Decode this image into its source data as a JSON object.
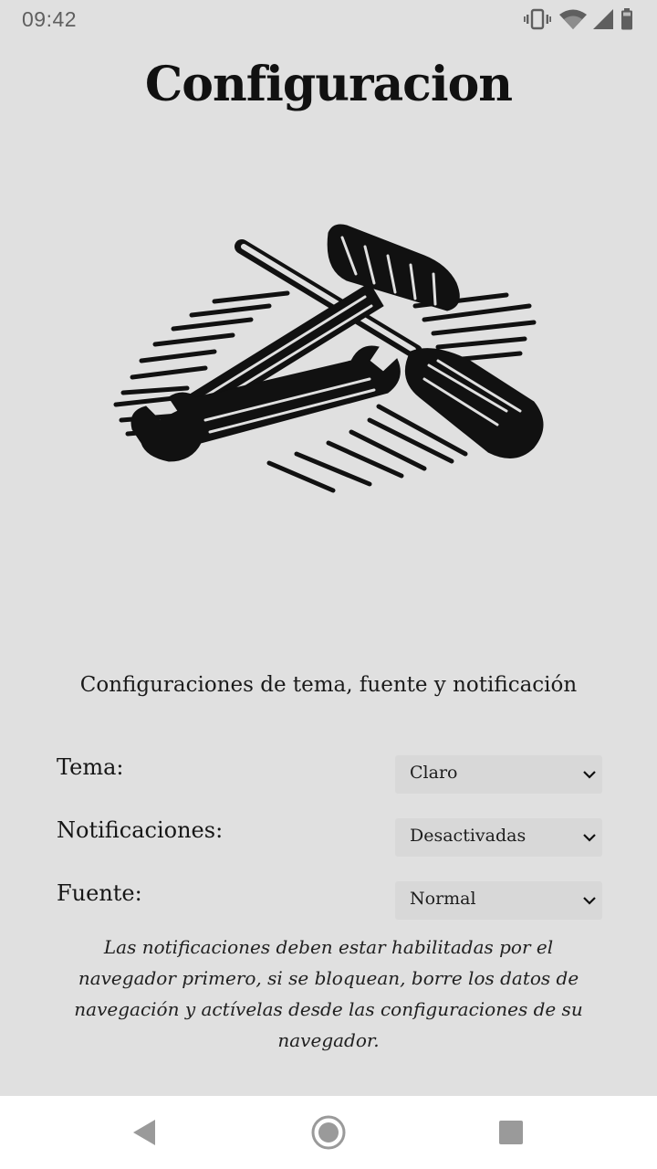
{
  "status_bar": {
    "time": "09:42",
    "icons": [
      "vibrate-icon",
      "wifi-icon",
      "signal-icon",
      "battery-icon"
    ]
  },
  "page": {
    "title": "Configuracion",
    "illustration": "tools-icon",
    "subtitle": "Configuraciones de tema, fuente y notificación"
  },
  "settings": {
    "theme": {
      "label": "Tema:",
      "value": "Claro"
    },
    "notifications": {
      "label": "Notificaciones:",
      "value": "Desactivadas"
    },
    "font": {
      "label": "Fuente:",
      "value": "Normal"
    }
  },
  "help_text": "Las notificaciones deben estar habilitadas por el navegador primero, si se bloquean, borre los datos de navegación y actívelas desde las configuraciones de su navegador.",
  "nav_bar": {
    "buttons": [
      "back-icon",
      "home-icon",
      "recents-icon"
    ]
  },
  "colors": {
    "background": "#e0e0e0",
    "select_background": "#d8d8d8",
    "nav_background": "#ffffff",
    "text": "#141414"
  }
}
